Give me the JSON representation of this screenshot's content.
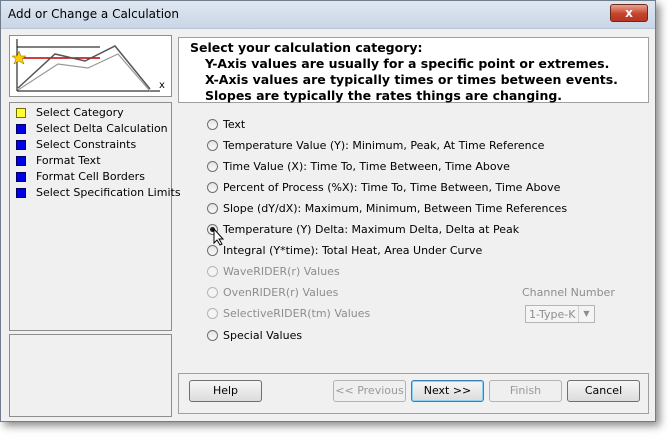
{
  "window": {
    "title": "Add or Change a Calculation",
    "close_glyph": "x"
  },
  "thumbnail": {
    "x_axis_label": "x"
  },
  "steps": [
    {
      "label": "Select Category",
      "current": true
    },
    {
      "label": "Select Delta Calculation",
      "current": false
    },
    {
      "label": "Select Constraints",
      "current": false
    },
    {
      "label": "Format Text",
      "current": false
    },
    {
      "label": "Format Cell Borders",
      "current": false
    },
    {
      "label": "Select Specification Limits",
      "current": false
    }
  ],
  "header": {
    "title": "Select your calculation category:",
    "lines": [
      "Y-Axis values are usually for a specific point or extremes.",
      "X-Axis values are typically times or times between events.",
      "Slopes are typically the rates things are changing."
    ]
  },
  "options": [
    {
      "label": "Text",
      "enabled": true,
      "checked": false
    },
    {
      "label": "Temperature Value (Y):  Minimum, Peak, At Time Reference",
      "enabled": true,
      "checked": false
    },
    {
      "label": "Time Value (X):  Time To, Time Between, Time Above",
      "enabled": true,
      "checked": false
    },
    {
      "label": "Percent of Process (%X):  Time To, Time Between, Time Above",
      "enabled": true,
      "checked": false
    },
    {
      "label": "Slope (dY/dX):  Maximum, Minimum, Between Time References",
      "enabled": true,
      "checked": false
    },
    {
      "label": "Temperature (Y) Delta:  Maximum Delta, Delta at Peak",
      "enabled": true,
      "checked": true
    },
    {
      "label": "Integral (Y*time): Total Heat, Area Under Curve",
      "enabled": true,
      "checked": false
    },
    {
      "label": "WaveRIDER(r) Values",
      "enabled": false,
      "checked": false
    },
    {
      "label": "OvenRIDER(r) Values",
      "enabled": false,
      "checked": false
    },
    {
      "label": "SelectiveRIDER(tm) Values",
      "enabled": false,
      "checked": false
    },
    {
      "label": "Special  Values",
      "enabled": true,
      "checked": false
    }
  ],
  "channel": {
    "label": "Channel Number",
    "value": "1-Type-K"
  },
  "buttons": {
    "help": "Help",
    "previous": "<< Previous",
    "next": "Next >>",
    "finish": "Finish",
    "cancel": "Cancel"
  },
  "colors": {
    "current_step": "#ffff33",
    "pending_step": "#0000e8",
    "close_button": "#c7432b"
  }
}
